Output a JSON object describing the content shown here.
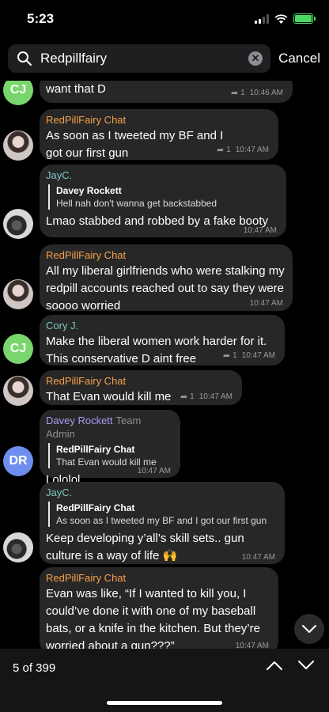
{
  "status": {
    "time": "5:23"
  },
  "search": {
    "query": "Redpillfairy",
    "cancel_label": "Cancel"
  },
  "messages": [
    {
      "avatar": "CJ",
      "text": "want that D",
      "replies": "1",
      "time": "10:46 AM"
    },
    {
      "sender": "RedPillFairy Chat",
      "text": "As soon as I tweeted my BF and I got our first gun",
      "replies": "1",
      "time": "10:47 AM"
    },
    {
      "sender": "JayC.",
      "quote_author": "Davey Rockett",
      "quote_text": "Hell nah don't wanna get backstabbed",
      "text": "Lmao stabbed and robbed by a fake booty",
      "time": "10:47 AM"
    },
    {
      "sender": "RedPillFairy Chat",
      "text": "All my liberal girlfriends who were stalking my redpill accounts reached out to say they were soooo worried",
      "time": "10:47 AM"
    },
    {
      "sender": "Cory J.",
      "avatar": "CJ",
      "text": "Make the liberal women work harder for it. This conservative D aint free",
      "replies": "1",
      "time": "10:47 AM"
    },
    {
      "sender": "RedPillFairy Chat",
      "text": "That Evan would kill me",
      "replies": "1",
      "time": "10:47 AM"
    },
    {
      "sender": "Davey Rockett",
      "role": "Team Admin",
      "avatar": "DR",
      "quote_author": "RedPillFairy Chat",
      "quote_text": "That Evan would kill me",
      "text": "Lololol",
      "time": "10:47 AM"
    },
    {
      "sender": "JayC.",
      "quote_author": "RedPillFairy Chat",
      "quote_text": "As soon as I tweeted my BF and I got our first gun",
      "text": "Keep developing y’all’s skill sets.. gun culture is a way of life 🙌",
      "time": "10:47 AM"
    },
    {
      "sender": "RedPillFairy Chat",
      "text": "Evan was like, “If I wanted to kill you, I could’ve done it with one of my baseball bats, or a knife in the kitchen. But they’re worried about a gun???”",
      "time": "10:47 AM"
    }
  ],
  "footer": {
    "result_count": "5 of 399"
  },
  "colors": {
    "accent_green": "#4cd964",
    "sender_orange": "#f5a04a",
    "sender_teal": "#7ec8c0",
    "sender_purple": "#a99bf0",
    "bubble": "#272727"
  }
}
